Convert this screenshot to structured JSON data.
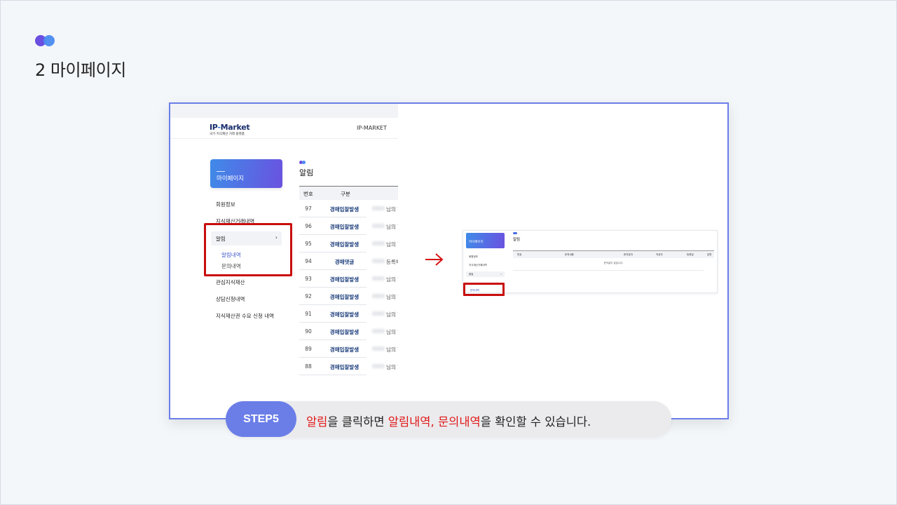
{
  "page": {
    "heading": "2 마이페이지",
    "colors": {
      "accent": "#6b7ee8",
      "highlight": "#c80d0d",
      "red_text": "#e01818"
    }
  },
  "left_shot": {
    "brand_name_a": "IP",
    "brand_name_dash": "-",
    "brand_name_b": "Market",
    "brand_sub": "국가 지식재산 거래 플랫폼",
    "header_right": "IP-MARKET",
    "mypage_label": "마이페이지",
    "menu": {
      "member": "회원정보",
      "ip_trade": "지식재산거래내역",
      "alarm": "알림",
      "alarm_chevron": "›",
      "alarm_list": "알림내역",
      "inquiry_list": "문의내역",
      "interest": "관심지식재산",
      "consult": "상담신청내역",
      "demand": "지식재산권 수요 신청 내역"
    },
    "list_title": "알림",
    "table": {
      "col_no": "번호",
      "col_type": "구분",
      "rows": [
        {
          "no": "97",
          "type": "경매입찰발생",
          "tail": "님의 ?"
        },
        {
          "no": "96",
          "type": "경매입찰발생",
          "tail": "님의 ?"
        },
        {
          "no": "95",
          "type": "경매입찰발생",
          "tail": "님의 ?"
        },
        {
          "no": "94",
          "type": "경매댓글",
          "tail": "등록해"
        },
        {
          "no": "93",
          "type": "경매입찰발생",
          "tail": "님의 ?"
        },
        {
          "no": "92",
          "type": "경매입찰발생",
          "tail": "님의 ?"
        },
        {
          "no": "91",
          "type": "경매입찰발생",
          "tail": "님의 ?"
        },
        {
          "no": "90",
          "type": "경매입찰발생",
          "tail": "님의 ?"
        },
        {
          "no": "89",
          "type": "경매입찰발생",
          "tail": "님의 ?"
        },
        {
          "no": "88",
          "type": "경매입찰발생",
          "tail": "님의 ?"
        }
      ]
    }
  },
  "right_thumb": {
    "mypage_label": "마이페이지",
    "menu_member": "회원정보",
    "menu_trade": "지식재산거래내역",
    "menu_alarm": "알림",
    "menu_alarm_chevron": "›",
    "menu_inquiry": "문의내역",
    "title": "알림",
    "headers": [
      "번호",
      "문의내용",
      "문의분야",
      "작성자",
      "등록일",
      "답변"
    ],
    "empty_message": "문의글이 없습니다."
  },
  "arrow_icon": "right-arrow",
  "step": {
    "badge": "STEP5",
    "part1": "알림",
    "part2": "을 클릭하면 ",
    "part3": "알림내역, 문의내역",
    "part4": "을 확인할 수 있습니다."
  }
}
